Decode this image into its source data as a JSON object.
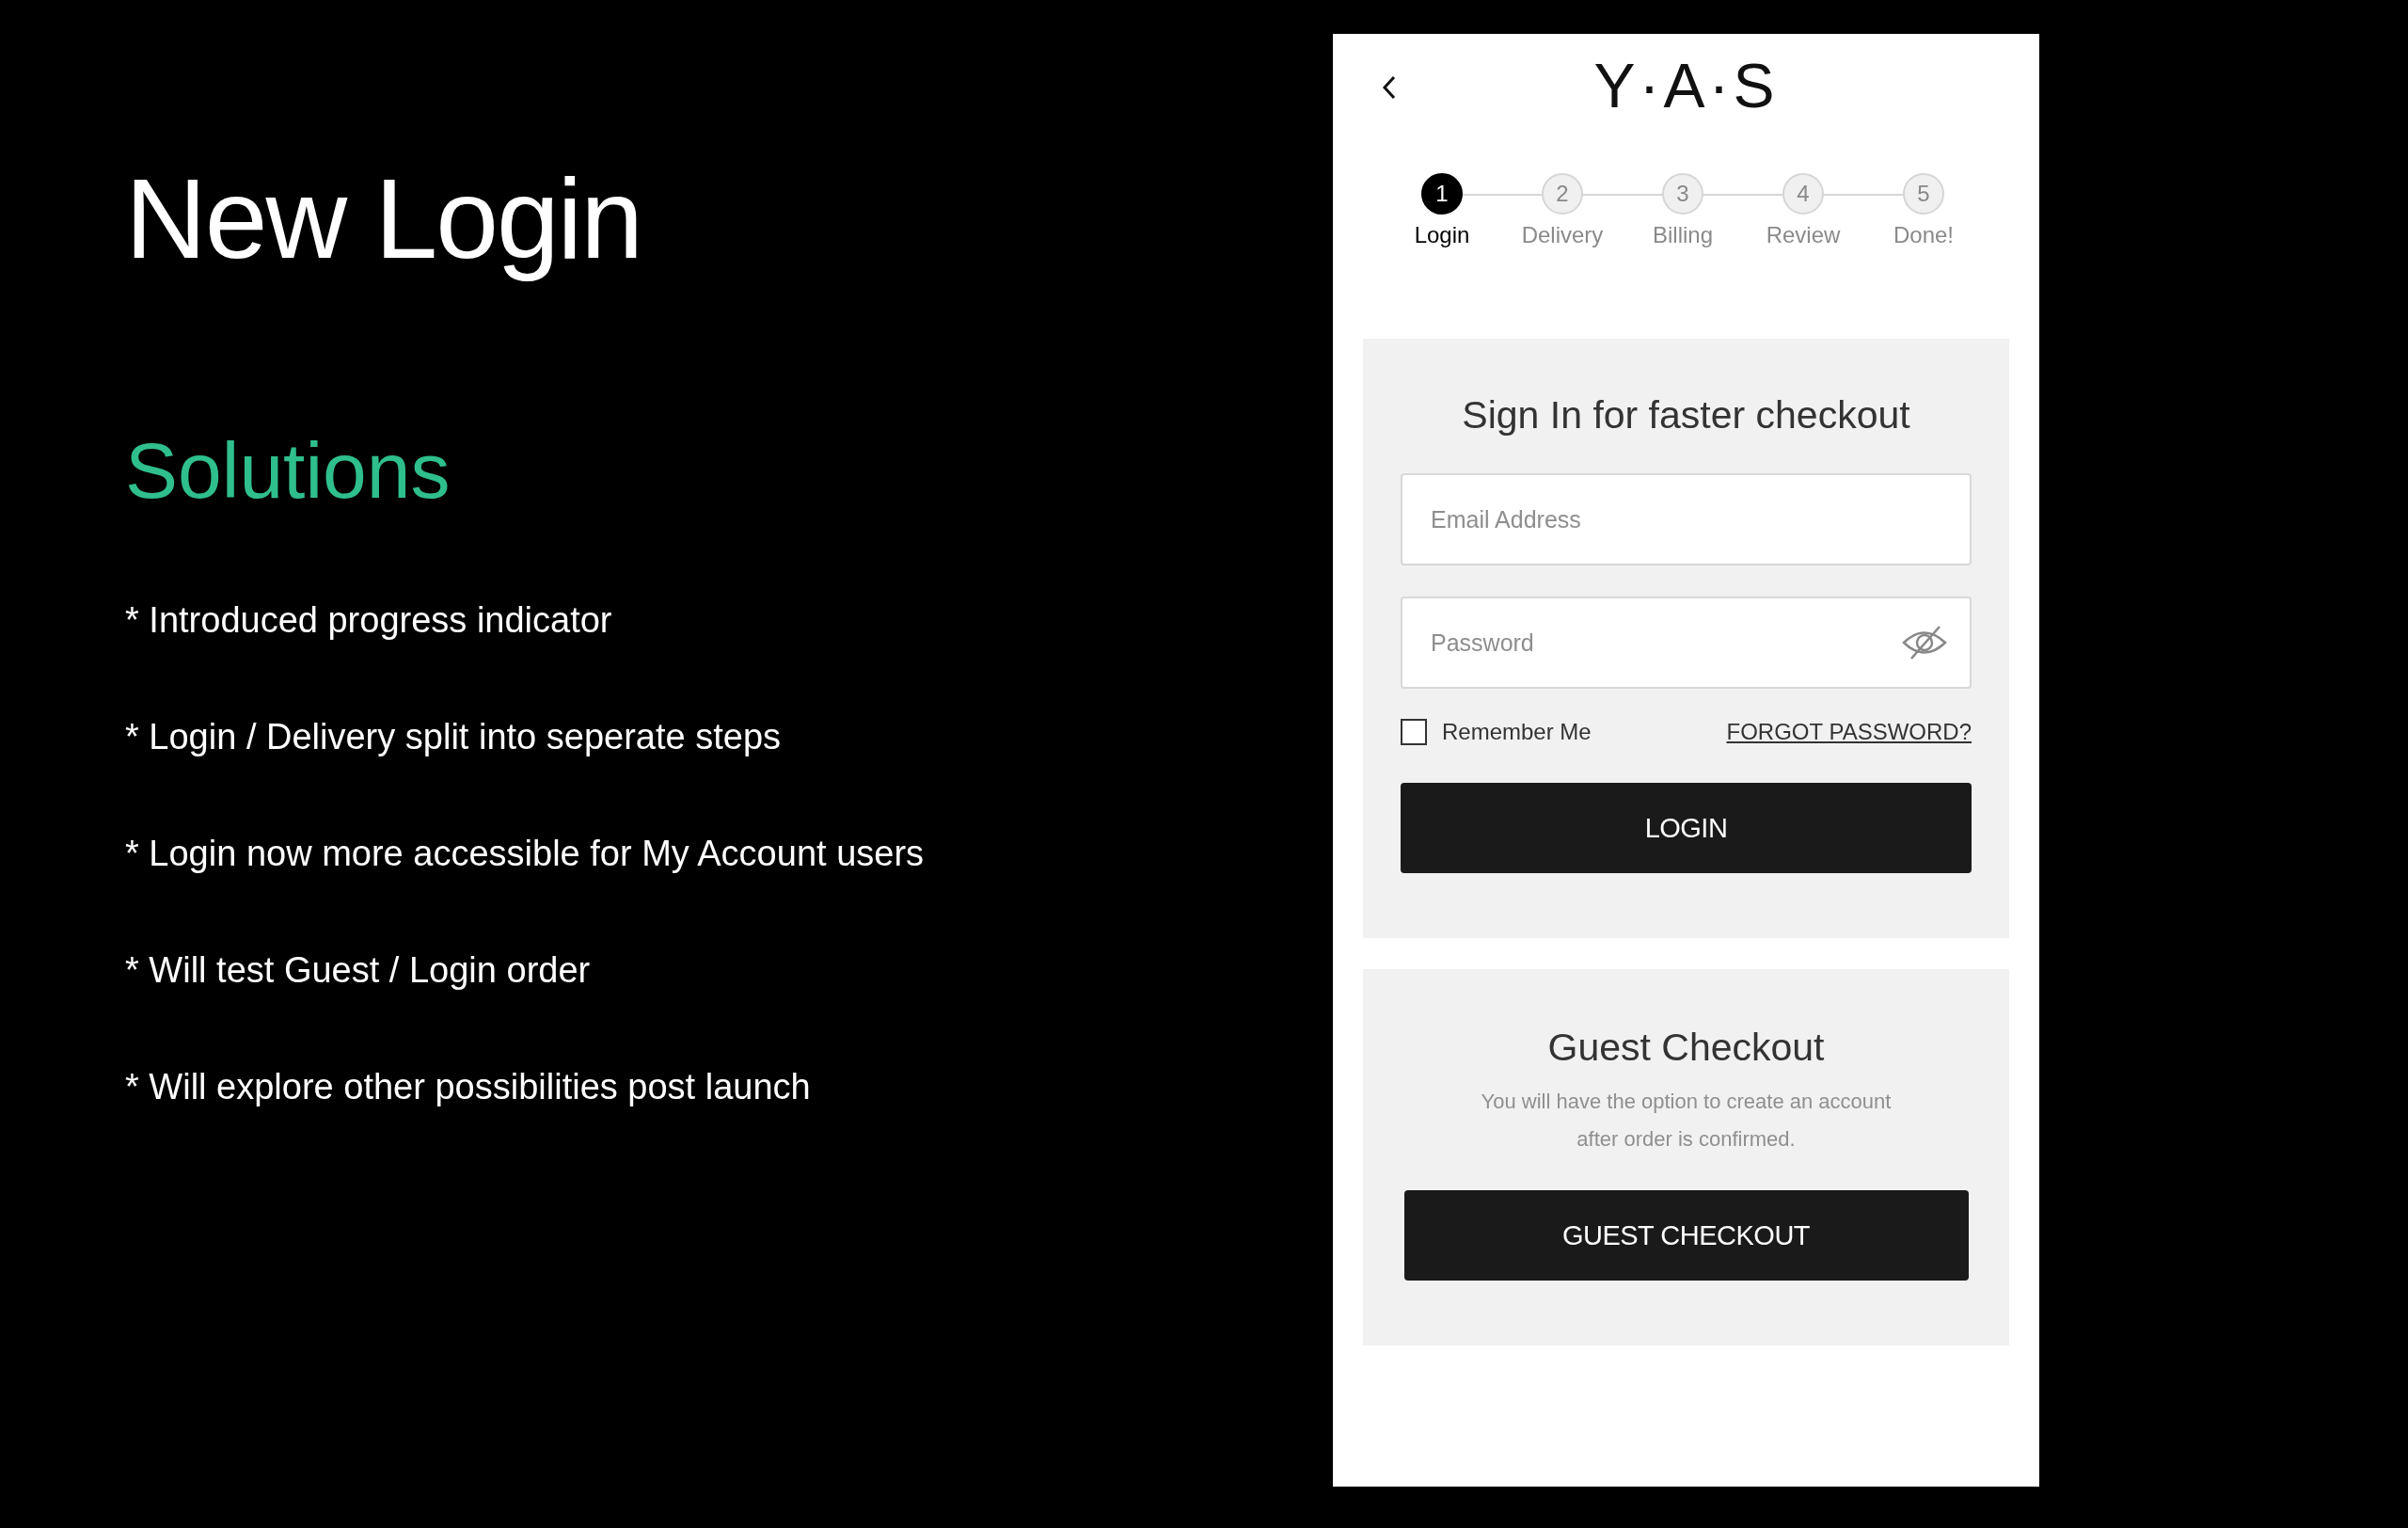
{
  "slide": {
    "title": "New Login",
    "subtitle": "Solutions",
    "bullets": [
      "* Introduced progress indicator",
      "* Login / Delivery split into seperate steps",
      "* Login now more accessible for My Account users",
      "* Will test Guest / Login order",
      "* Will explore other possibilities post launch"
    ]
  },
  "phone": {
    "logo": "Y·A·S",
    "steps": [
      {
        "number": "1",
        "label": "Login",
        "selected": true
      },
      {
        "number": "2",
        "label": "Delivery",
        "selected": false
      },
      {
        "number": "3",
        "label": "Billing",
        "selected": false
      },
      {
        "number": "4",
        "label": "Review",
        "selected": false
      },
      {
        "number": "5",
        "label": "Done!",
        "selected": false
      }
    ],
    "sign_in": {
      "title": "Sign In for faster checkout",
      "email": {
        "placeholder": "Email Address"
      },
      "password": {
        "placeholder": "Password"
      },
      "remember_me": {
        "label": "Remember Me",
        "checked": false
      },
      "forgot_link": "FORGOT PASSWORD?",
      "login_button": "LOGIN"
    },
    "guest": {
      "title": "Guest Checkout",
      "description": "You will have the option to create an account after order is confirmed.",
      "button": "GUEST CHECKOUT"
    }
  }
}
